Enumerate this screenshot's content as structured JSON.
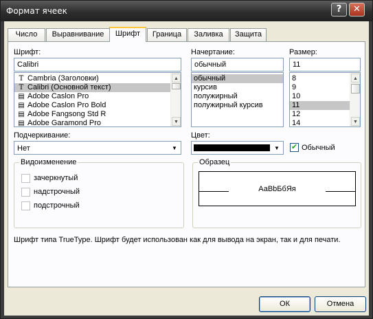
{
  "window": {
    "title": "Формат ячеек",
    "help_glyph": "?",
    "close_glyph": "✕"
  },
  "tabs": [
    {
      "label": "Число"
    },
    {
      "label": "Выравнивание"
    },
    {
      "label": "Шрифт"
    },
    {
      "label": "Граница"
    },
    {
      "label": "Заливка"
    },
    {
      "label": "Защита"
    }
  ],
  "font": {
    "label": "Шрифт:",
    "value": "Calibri",
    "items": [
      {
        "name": "Cambria (Заголовки)",
        "icon": "truetype-icon",
        "glyph": "T"
      },
      {
        "name": "Calibri (Основной текст)",
        "icon": "truetype-icon",
        "glyph": "T"
      },
      {
        "name": "Adobe Caslon Pro",
        "icon": "opentype-icon",
        "glyph": "▤"
      },
      {
        "name": "Adobe Caslon Pro Bold",
        "icon": "opentype-icon",
        "glyph": "▤"
      },
      {
        "name": "Adobe Fangsong Std R",
        "icon": "opentype-icon",
        "glyph": "▤"
      },
      {
        "name": "Adobe Garamond Pro",
        "icon": "opentype-icon",
        "glyph": "▤"
      }
    ]
  },
  "style": {
    "label": "Начертание:",
    "value": "обычный",
    "items": [
      "обычный",
      "курсив",
      "полужирный",
      "полужирный курсив"
    ]
  },
  "size": {
    "label": "Размер:",
    "value": "11",
    "items": [
      "8",
      "9",
      "10",
      "11",
      "12",
      "14"
    ]
  },
  "underline": {
    "label": "Подчеркивание:",
    "value": "Нет"
  },
  "color": {
    "label": "Цвет:",
    "swatch": "#000000",
    "normal_label": "Обычный",
    "normal_checked": true
  },
  "effects": {
    "title": "Видоизменение",
    "items": [
      {
        "label": "зачеркнутый"
      },
      {
        "label": "надстрочный"
      },
      {
        "label": "подстрочный"
      }
    ]
  },
  "preview": {
    "title": "Образец",
    "text": "АаBbБбЯя"
  },
  "info_text": "Шрифт типа TrueType. Шрифт будет использован как для вывода на экран, так и для печати.",
  "buttons": {
    "ok": "ОК",
    "cancel": "Отмена"
  },
  "icons": {
    "arrow_up": "▲",
    "arrow_down": "▼",
    "check": "✔"
  }
}
